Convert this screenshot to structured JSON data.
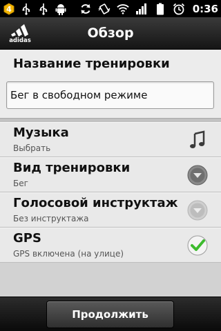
{
  "status_bar": {
    "notification_count": "4",
    "time": "0:36",
    "icons": [
      "notification-badge-icon",
      "usb-icon",
      "usb-icon",
      "android-icon",
      "sync-icon",
      "vibrate-icon",
      "wifi-icon",
      "signal-icon",
      "battery-icon",
      "alarm-icon"
    ]
  },
  "header": {
    "title": "Обзор",
    "logo_text": "adidas"
  },
  "workout_name": {
    "label": "Название тренировки",
    "value": "Бег в свободном режиме"
  },
  "settings": [
    {
      "title": "Музыка",
      "subtitle": "Выбрать",
      "icon": "music-note-icon"
    },
    {
      "title": "Вид тренировки",
      "subtitle": "Бег",
      "icon": "dropdown-icon"
    },
    {
      "title": "Голосовой инструктаж",
      "subtitle": "Без инструктажа",
      "icon": "dropdown-disabled-icon"
    },
    {
      "title": "GPS",
      "subtitle": "GPS включена (на улице)",
      "icon": "checkbox-checked-icon"
    }
  ],
  "footer": {
    "continue_label": "Продолжить"
  },
  "colors": {
    "background": "#dcdcdc",
    "titlebar": "#1e1e1e",
    "check_green": "#3dbb2e"
  }
}
